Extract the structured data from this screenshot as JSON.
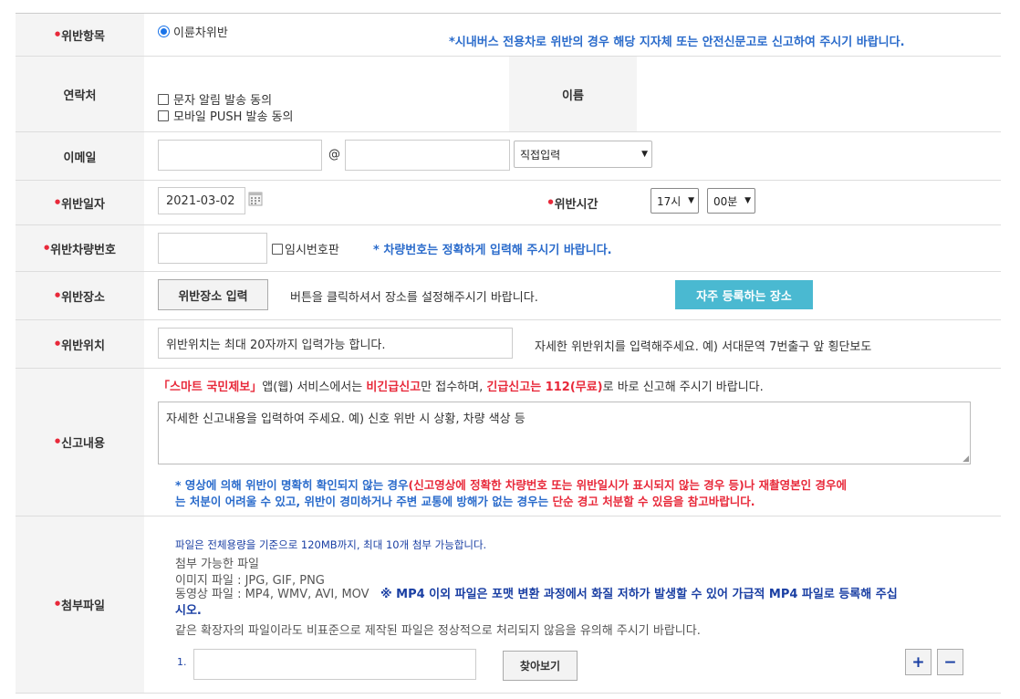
{
  "violation_item": {
    "label": "위반항목",
    "radio_label": "이륜차위반",
    "notice": "*시내버스 전용차로 위반의 경우 해당 지자체 또는 안전신문고로 신고하여 주시기 바랍니다."
  },
  "contact": {
    "label": "연락처",
    "sms_consent": "문자 알림 발송 동의",
    "push_consent": "모바일 PUSH 발송 동의",
    "name_label": "이름"
  },
  "email": {
    "label": "이메일",
    "at_sign": "@",
    "local_value": "",
    "domain_value": "",
    "domain_select": "직접입력"
  },
  "date": {
    "label": "위반일자",
    "value": "2021-03-02",
    "time_label": "위반시간",
    "hour": "17시",
    "minute": "00분"
  },
  "plate": {
    "label": "위반차량번호",
    "value": "",
    "temp_plate": "임시번호판",
    "notice": "* 차량번호는 정확하게 입력해 주시기 바랍니다."
  },
  "location": {
    "label": "위반장소",
    "button": "위반장소 입력",
    "hint": "버튼을 클릭하셔서 장소를 설정해주시기 바랍니다.",
    "frequent_button": "자주 등록하는 장소"
  },
  "position": {
    "label": "위반위치",
    "value": "위반위치는 최대 20자까지 입력가능 합니다.",
    "hint": "자세한 위반위치를 입력해주세요. 예) 서대문역 7번출구 앞 횡단보도"
  },
  "report": {
    "label": "신고내용",
    "notice_part1": "「스마트 국민제보」",
    "notice_part2": "앱(웹) 서비스에서는 ",
    "notice_part3": "비긴급신고",
    "notice_part4": "만 접수하며, ",
    "notice_part5": "긴급신고는 112(무료)",
    "notice_part6": "로 바로 신고해 주시기 바랍니다.",
    "textarea_value": "자세한 신고내용을 입력하여 주세요. 예) 신호 위반 시 상황, 차량 색상 등",
    "caution_line1_a": "* 영상에 의해 위반이 명확히 확인되지 않는 경우",
    "caution_line1_b": "(신고영상에 정확한 차량번호 또는 위반일시가 표시되지 않는 경우 등)나 재촬영본인 경우에",
    "caution_line2_a": "는 처분이 어려울 수 있고, 위반이 경미하거나 주변 교통에 방해가 없는 경우는 ",
    "caution_line2_b": "단순 경고 처분할 수 있음을 참고바랍니다."
  },
  "attachment": {
    "label": "첨부파일",
    "capacity": "파일은 전체용량을 기준으로 120MB까지, 최대 10개 첨부 가능합니다.",
    "allowed_title": "첨부 가능한 파일",
    "image_types": "이미지 파일 : JPG, GIF, PNG",
    "video_types": "동영상 파일 : MP4, WMV, AVI, MOV",
    "mp4_notice_line1": "※ MP4 이외 파일은 포맷 변환 과정에서 화질 저하가 발생할 수 있어 가급적 MP4 파일로 등록해 주십",
    "mp4_notice_line2": "시오.",
    "nonstandard_notice": "같은 확장자의 파일이라도 비표준으로 제작된 파일은 정상적으로 처리되지 않음을 유의해 주시기 바랍니다.",
    "file_index": "1.",
    "file_value": "",
    "browse_button": "찾아보기",
    "add_symbol": "+",
    "remove_symbol": "−"
  },
  "colors": {
    "accent_button": "#4ab9d1",
    "blue_notice": "#2a6bcb",
    "red_notice": "#e8293a",
    "header_bg": "#f4f4f4"
  }
}
